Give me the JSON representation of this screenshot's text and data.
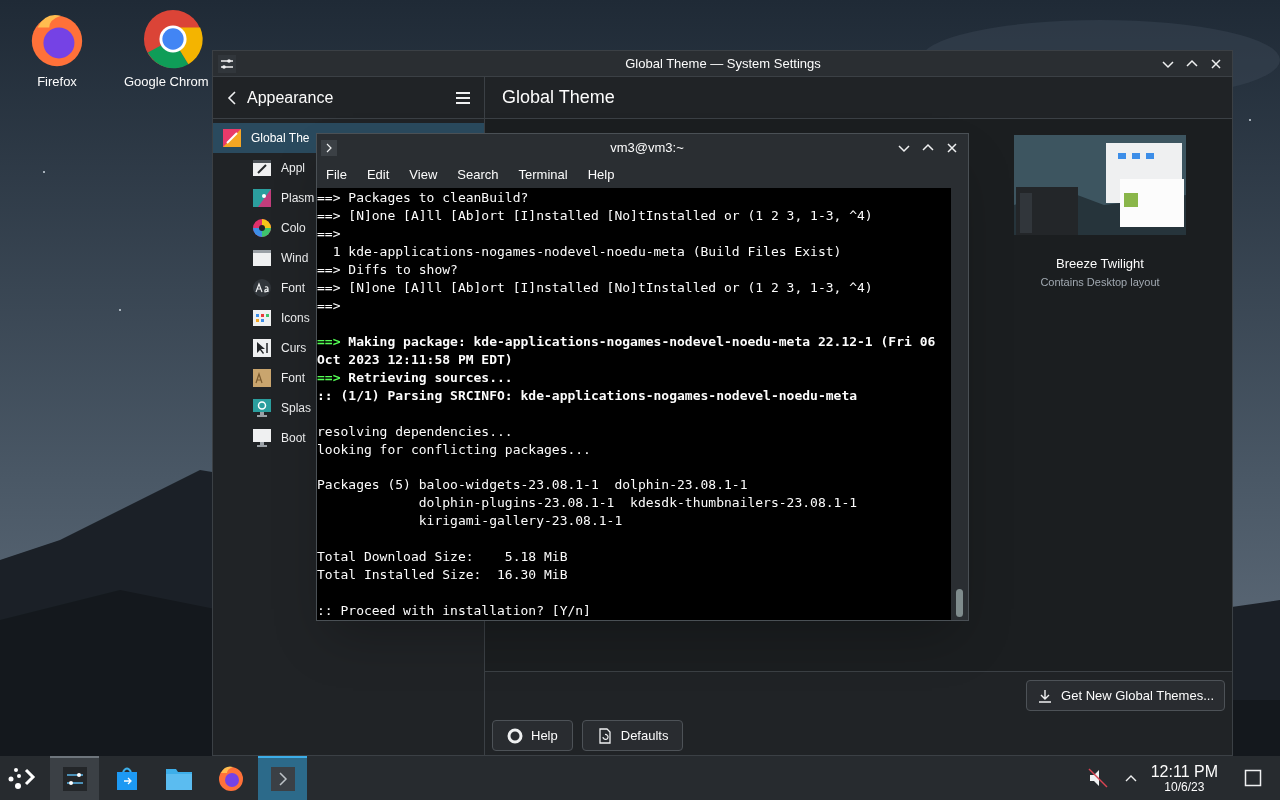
{
  "desktop_icons": [
    {
      "label": "Firefox",
      "kind": "firefox"
    },
    {
      "label": "Google Chrom",
      "kind": "chrome"
    }
  ],
  "settings_window": {
    "title": "Global Theme — System Settings",
    "sidebar": {
      "header": "Appearance",
      "items": [
        {
          "label": "Global The",
          "kind": "global",
          "selected": true
        },
        {
          "label": "Appl",
          "kind": "app",
          "selected": false
        },
        {
          "label": "Plasm",
          "kind": "plasma",
          "selected": false
        },
        {
          "label": "Colo",
          "kind": "colors",
          "selected": false
        },
        {
          "label": "Wind",
          "kind": "window",
          "selected": false
        },
        {
          "label": "Font",
          "kind": "fonts",
          "selected": false
        },
        {
          "label": "Icons",
          "kind": "icons",
          "selected": false
        },
        {
          "label": "Curs",
          "kind": "cursors",
          "selected": false
        },
        {
          "label": "Font",
          "kind": "fontmgmt",
          "selected": false
        },
        {
          "label": "Splas",
          "kind": "splash",
          "selected": false
        },
        {
          "label": "Boot",
          "kind": "boot",
          "selected": false
        }
      ]
    },
    "page_title": "Global Theme",
    "themes": [
      {
        "name": "Breeze Twilight",
        "note": "Contains Desktop layout",
        "kind": "picture"
      }
    ],
    "get_new_button": "Get New Global Themes...",
    "footer_buttons": [
      {
        "label": "Help",
        "kind": "help"
      },
      {
        "label": "Defaults",
        "kind": "defaults"
      }
    ]
  },
  "terminal": {
    "title": "vm3@vm3:~",
    "menu": [
      "File",
      "Edit",
      "View",
      "Search",
      "Terminal",
      "Help"
    ],
    "lines": [
      {
        "kind": "plain",
        "text": "==> Packages to cleanBuild?"
      },
      {
        "kind": "plain",
        "text": "==> [N]one [A]ll [Ab]ort [I]nstalled [No]tInstalled or (1 2 3, 1-3, ^4)"
      },
      {
        "kind": "plain",
        "text": "==>"
      },
      {
        "kind": "plain",
        "text": "  1 kde-applications-nogames-nodevel-noedu-meta (Build Files Exist)"
      },
      {
        "kind": "plain",
        "text": "==> Diffs to show?"
      },
      {
        "kind": "plain",
        "text": "==> [N]one [A]ll [Ab]ort [I]nstalled [No]tInstalled or (1 2 3, 1-3, ^4)"
      },
      {
        "kind": "plain",
        "text": "==>"
      },
      {
        "kind": "blank"
      },
      {
        "kind": "arrow",
        "prefix": "==>",
        "text": " Making package: kde-applications-nogames-nodevel-noedu-meta 22.12-1 (Fri 06"
      },
      {
        "kind": "bold",
        "text": "Oct 2023 12:11:58 PM EDT)"
      },
      {
        "kind": "arrow",
        "prefix": "==>",
        "text": " Retrieving sources..."
      },
      {
        "kind": "bold",
        "text": ":: (1/1) Parsing SRCINFO: kde-applications-nogames-nodevel-noedu-meta"
      },
      {
        "kind": "blank"
      },
      {
        "kind": "plain",
        "text": "resolving dependencies..."
      },
      {
        "kind": "plain",
        "text": "looking for conflicting packages..."
      },
      {
        "kind": "blank"
      },
      {
        "kind": "plain",
        "text": "Packages (5) baloo-widgets-23.08.1-1  dolphin-23.08.1-1"
      },
      {
        "kind": "plain",
        "text": "             dolphin-plugins-23.08.1-1  kdesdk-thumbnailers-23.08.1-1"
      },
      {
        "kind": "plain",
        "text": "             kirigami-gallery-23.08.1-1"
      },
      {
        "kind": "blank"
      },
      {
        "kind": "plain",
        "text": "Total Download Size:    5.18 MiB"
      },
      {
        "kind": "plain",
        "text": "Total Installed Size:  16.30 MiB"
      },
      {
        "kind": "blank"
      },
      {
        "kind": "plain",
        "text": ":: Proceed with installation? [Y/n]"
      }
    ]
  },
  "taskbar": {
    "apps": [
      {
        "kind": "settings",
        "active": false,
        "open": true
      },
      {
        "kind": "store",
        "active": false,
        "open": false
      },
      {
        "kind": "files",
        "active": false,
        "open": false
      },
      {
        "kind": "firefox",
        "active": false,
        "open": false
      },
      {
        "kind": "terminal",
        "active": true,
        "open": true
      }
    ],
    "time": "12:11 PM",
    "date": "10/6/23"
  }
}
